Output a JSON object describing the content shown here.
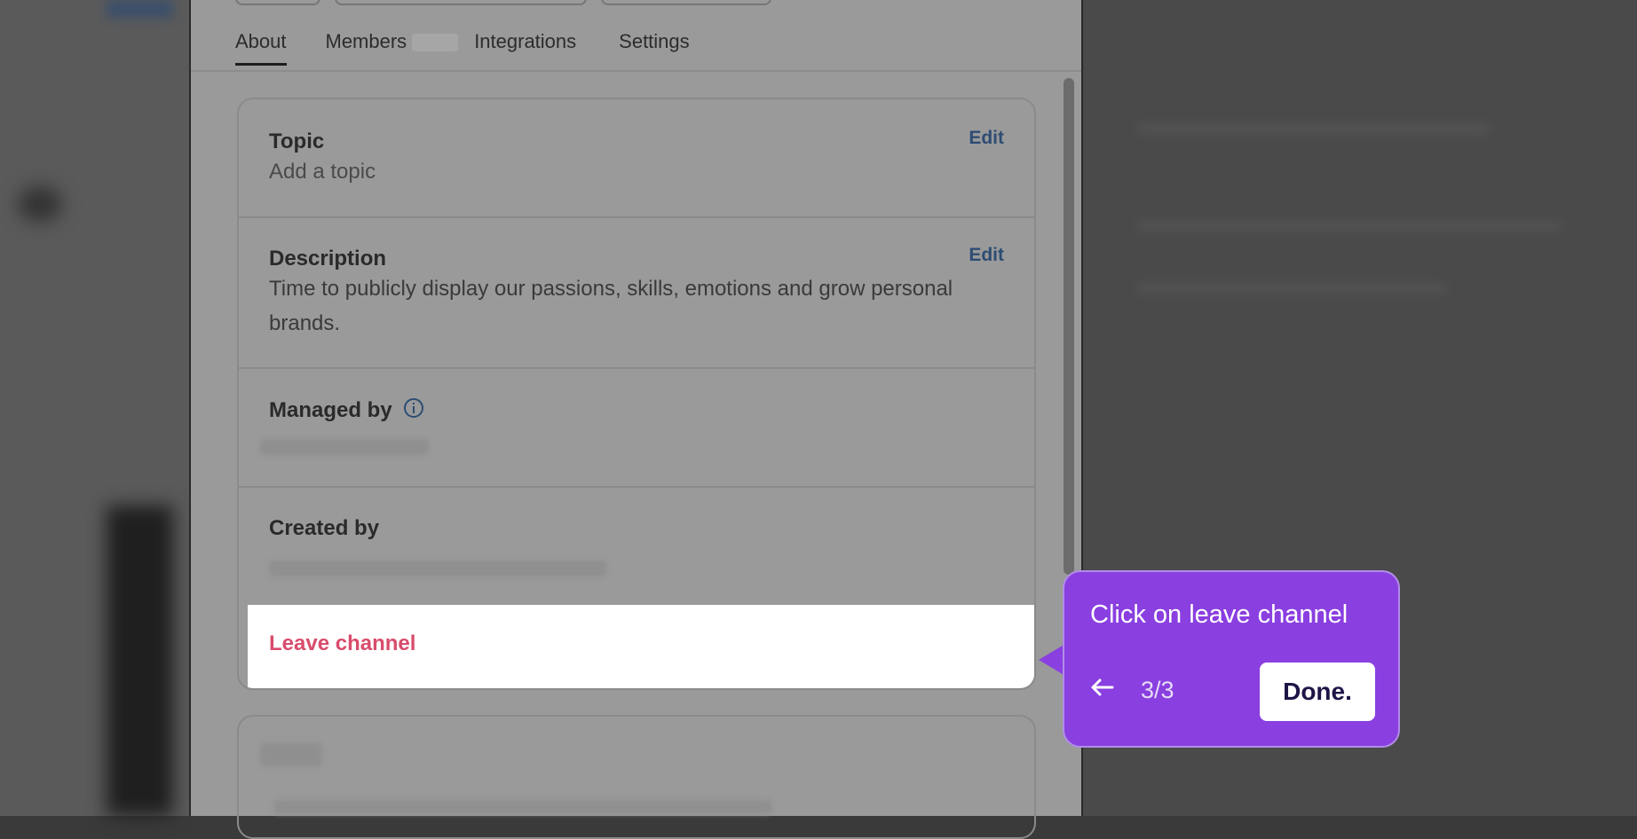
{
  "tabs": [
    {
      "label": "About"
    },
    {
      "label": "Members"
    },
    {
      "label": "Integrations"
    },
    {
      "label": "Settings"
    }
  ],
  "about": {
    "topic": {
      "title": "Topic",
      "value": "Add a topic",
      "edit_label": "Edit"
    },
    "description": {
      "title": "Description",
      "value": "Time to publicly display our passions, skills, emotions and grow personal brands.",
      "edit_label": "Edit"
    },
    "managed_by": {
      "title": "Managed by"
    },
    "created_by": {
      "title": "Created by"
    },
    "leave_channel_label": "Leave channel"
  },
  "tooltip": {
    "text": "Click on leave channel",
    "back_icon": "arrow-left-icon",
    "step": "3/3",
    "done_label": "Done."
  },
  "colors": {
    "accent_purple": "#8a3fe0",
    "leave_red": "#d94c6c",
    "edit_blue": "#2d4c73"
  }
}
